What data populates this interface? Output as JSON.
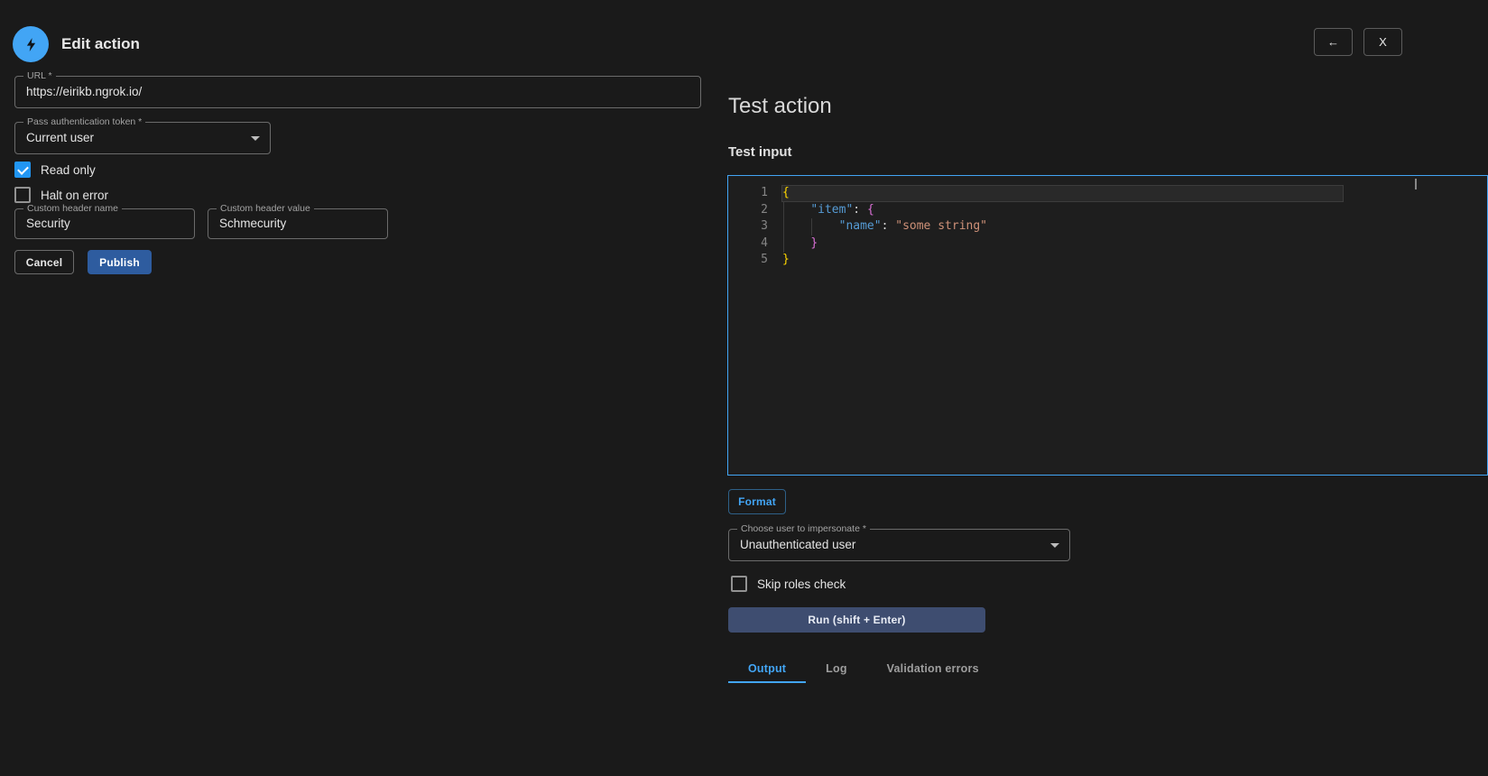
{
  "header": {
    "title": "Edit action",
    "back_label": "←",
    "close_label": "X"
  },
  "form": {
    "url": {
      "label": "URL *",
      "value": "https://eirikb.ngrok.io/"
    },
    "auth_token": {
      "label": "Pass authentication token *",
      "value": "Current user"
    },
    "read_only": {
      "label": "Read only",
      "checked": true
    },
    "halt_on_error": {
      "label": "Halt on error",
      "checked": false
    },
    "custom_header_name": {
      "label": "Custom header name",
      "value": "Security"
    },
    "custom_header_value": {
      "label": "Custom header value",
      "value": "Schmecurity"
    },
    "cancel_label": "Cancel",
    "publish_label": "Publish"
  },
  "test_panel": {
    "title": "Test action",
    "input_title": "Test input",
    "editor": {
      "palette": {
        "bracket1": "#ffd700",
        "bracket2": "#da70d6",
        "key": "#569cd6",
        "punct": "#d4d4d4",
        "string": "#ce9178"
      },
      "lines": [
        {
          "number": "1",
          "segments": [
            {
              "text": "{",
              "color": "bracket1"
            }
          ]
        },
        {
          "number": "2",
          "segments": [
            {
              "text": "    "
            },
            {
              "text": "\"item\"",
              "color": "key"
            },
            {
              "text": ": ",
              "color": "punct"
            },
            {
              "text": "{",
              "color": "bracket2"
            }
          ]
        },
        {
          "number": "3",
          "segments": [
            {
              "text": "        "
            },
            {
              "text": "\"name\"",
              "color": "key"
            },
            {
              "text": ": ",
              "color": "punct"
            },
            {
              "text": "\"some string\"",
              "color": "string"
            }
          ]
        },
        {
          "number": "4",
          "segments": [
            {
              "text": "    "
            },
            {
              "text": "}",
              "color": "bracket2"
            }
          ]
        },
        {
          "number": "5",
          "segments": [
            {
              "text": "}",
              "color": "bracket1"
            }
          ]
        }
      ]
    },
    "format_label": "Format",
    "impersonate": {
      "label": "Choose user to impersonate *",
      "value": "Unauthenticated user"
    },
    "skip_roles": {
      "label": "Skip roles check",
      "checked": false
    },
    "run_label": "Run (shift + Enter)",
    "tabs": [
      {
        "label": "Output",
        "active": true
      },
      {
        "label": "Log",
        "active": false
      },
      {
        "label": "Validation errors",
        "active": false
      }
    ]
  },
  "colors": {
    "accent": "#42a5f5",
    "checkbox": "#2196f3",
    "publish": "#2e5c9f",
    "run": "#3e4d70",
    "background": "#1a1a1a",
    "editor_bg": "#1e1e1e"
  }
}
